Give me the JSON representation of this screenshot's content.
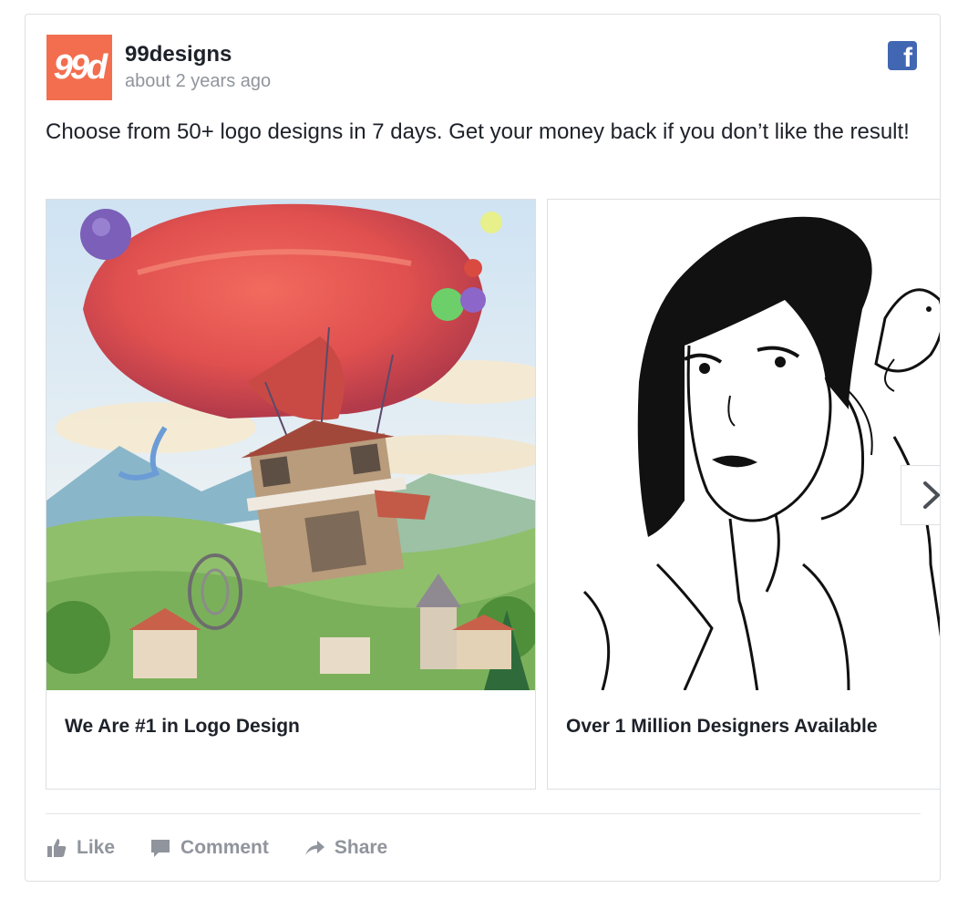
{
  "post": {
    "avatar_text": "99d",
    "page_name": "99designs",
    "timestamp": "about 2 years ago",
    "text": "Choose from 50+ logo designs in 7 days. Get your money back if you don’t like the result!"
  },
  "carousel": {
    "cards": [
      {
        "caption": "We Are #1 in Logo Design",
        "image": "hot-air-balloon-house-illustration"
      },
      {
        "caption": "Over 1 Million Designers Available",
        "image": "woman-with-bird-line-drawing"
      }
    ],
    "next_icon": "chevron-right-icon"
  },
  "actions": {
    "like": "Like",
    "comment": "Comment",
    "share": "Share"
  },
  "colors": {
    "brand": "#f26e4f",
    "facebook": "#4267b2",
    "muted": "#90949c"
  }
}
